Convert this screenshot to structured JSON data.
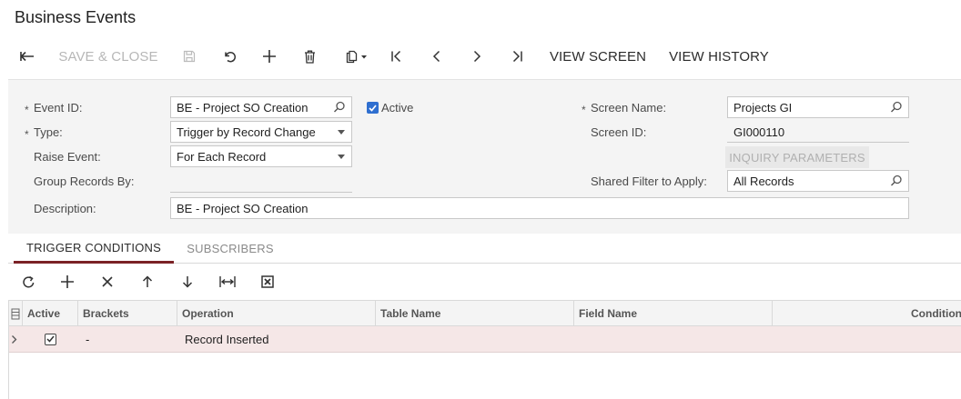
{
  "page": {
    "title": "Business Events"
  },
  "toolbar": {
    "save_close_label": "SAVE & CLOSE",
    "view_screen_label": "VIEW SCREEN",
    "view_history_label": "VIEW HISTORY"
  },
  "form": {
    "event_id": {
      "label": "Event ID:",
      "value": "BE - Project SO Creation"
    },
    "type": {
      "label": "Type:",
      "value": "Trigger by Record Change"
    },
    "raise_event": {
      "label": "Raise Event:",
      "value": "For Each Record"
    },
    "group_records_by": {
      "label": "Group Records By:",
      "value": ""
    },
    "description": {
      "label": "Description:",
      "value": "BE - Project SO Creation"
    },
    "active": {
      "label": "Active",
      "checked": true
    },
    "screen_name": {
      "label": "Screen Name:",
      "value": "Projects GI"
    },
    "screen_id": {
      "label": "Screen ID:",
      "value": "GI000110"
    },
    "inquiry_parameters_label": "INQUIRY PARAMETERS",
    "shared_filter": {
      "label": "Shared Filter to Apply:",
      "value": "All Records"
    },
    "required_marker": "*"
  },
  "tabs": [
    {
      "label": "TRIGGER CONDITIONS",
      "active": true
    },
    {
      "label": "SUBSCRIBERS",
      "active": false
    }
  ],
  "grid": {
    "columns": [
      "Active",
      "Brackets",
      "Operation",
      "Table Name",
      "Field Name",
      "Condition"
    ],
    "rows": [
      {
        "active": true,
        "brackets": "-",
        "operation": "Record Inserted",
        "table_name": "",
        "field_name": "",
        "condition": ""
      }
    ]
  },
  "colors": {
    "accent_tab": "#7b2226",
    "checkbox_blue": "#2f6fd0",
    "row_selected": "#f5e7e7"
  },
  "icons": [
    "back-arrow-icon",
    "save-icon",
    "undo-icon",
    "plus-icon",
    "trash-icon",
    "copy-paste-icon",
    "first-page-icon",
    "previous-icon",
    "next-icon",
    "last-page-icon",
    "search-icon",
    "refresh-icon",
    "close-icon",
    "arrow-up-icon",
    "arrow-down-icon",
    "fit-columns-icon",
    "excel-export-icon",
    "chevron-right-icon",
    "column-config-icon"
  ]
}
